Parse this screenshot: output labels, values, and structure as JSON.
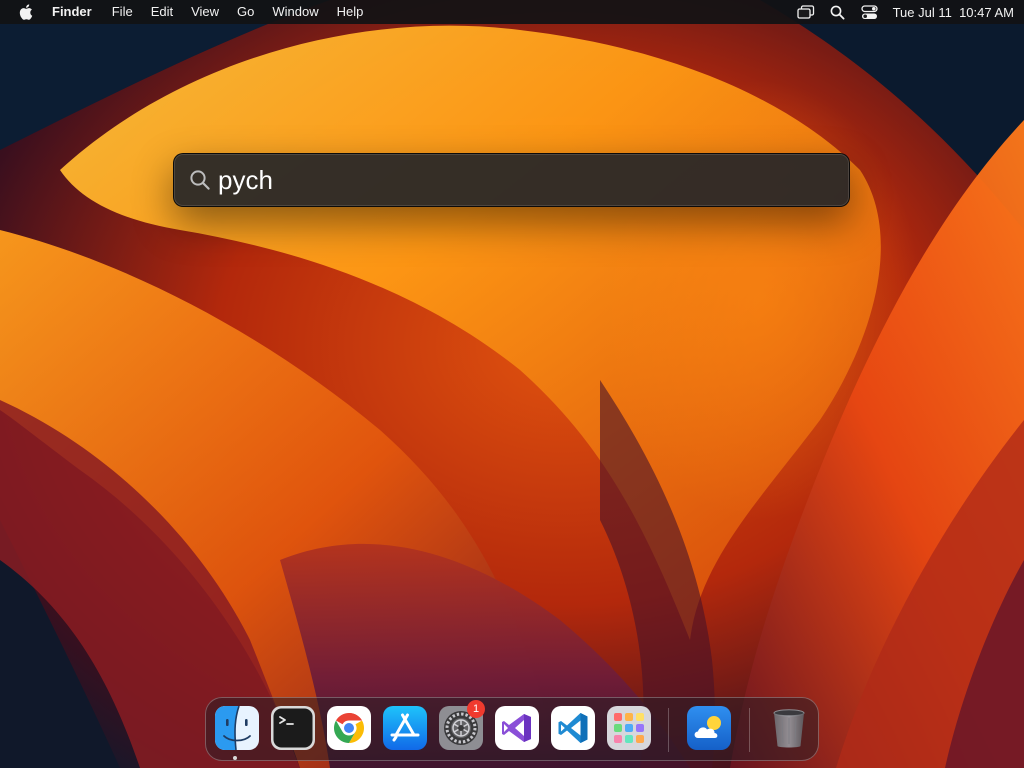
{
  "menubar": {
    "apple_icon": "apple-logo-icon",
    "app_name": "Finder",
    "menus": [
      "File",
      "Edit",
      "View",
      "Go",
      "Window",
      "Help"
    ],
    "status_icons": [
      "screen-mirroring-icon",
      "search-icon",
      "control-center-icon"
    ],
    "clock": "Tue Jul 11  10:47 AM"
  },
  "spotlight": {
    "icon": "search-icon",
    "query": "pych"
  },
  "dock": {
    "items": [
      {
        "name": "Finder",
        "icon": "finder-icon",
        "running": true
      },
      {
        "name": "Terminal",
        "icon": "terminal-icon",
        "running": false
      },
      {
        "name": "Google Chrome",
        "icon": "chrome-icon",
        "running": false
      },
      {
        "name": "App Store",
        "icon": "app-store-icon",
        "running": false
      },
      {
        "name": "System Settings",
        "icon": "system-settings-icon",
        "running": false,
        "badge": "1"
      },
      {
        "name": "Visual Studio",
        "icon": "visual-studio-icon",
        "running": false
      },
      {
        "name": "Visual Studio Code",
        "icon": "vscode-icon",
        "running": false
      },
      {
        "name": "Launchpad",
        "icon": "launchpad-icon",
        "running": false
      },
      {
        "name": "Weather",
        "icon": "weather-icon",
        "running": false
      },
      {
        "name": "Trash",
        "icon": "trash-icon",
        "running": false
      }
    ]
  },
  "colors": {
    "menubar_bg": "#121214",
    "spotlight_bg": "#262628",
    "badge": "#f03a2e",
    "wallpaper_orange": "#f5820f",
    "wallpaper_dark": "#0b1a2e"
  }
}
